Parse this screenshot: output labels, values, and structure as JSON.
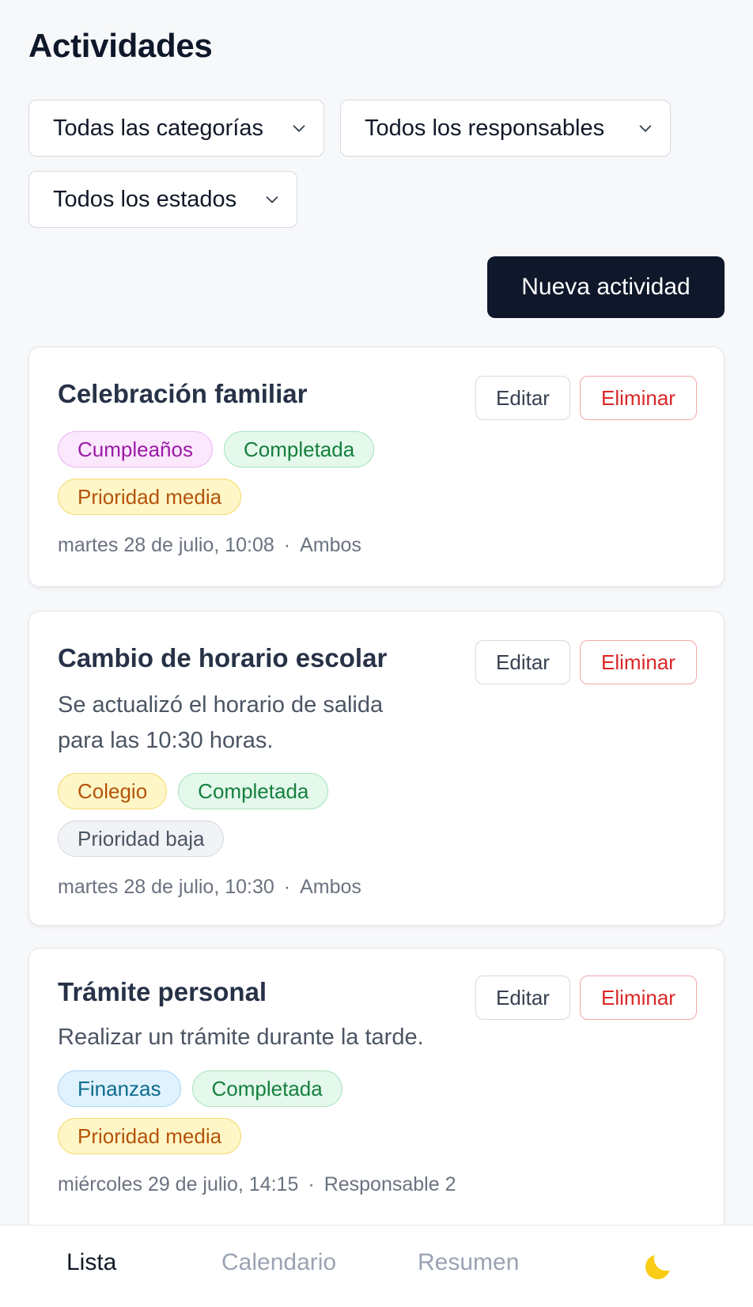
{
  "header": {
    "title": "Actividades"
  },
  "filters": {
    "category": "Todas las categorías",
    "responsible": "Todos los responsables",
    "status": "Todos los estados"
  },
  "actions": {
    "new_activity": "Nueva actividad"
  },
  "cards": [
    {
      "title": "Celebración familiar",
      "edit": "Editar",
      "delete": "Eliminar",
      "badges": [
        "Cumpleaños",
        "Completada",
        "Prioridad media"
      ],
      "date": "martes 28 de julio, 10:08",
      "separator": "·",
      "assignee": "Ambos"
    },
    {
      "title": "Cambio de horario escolar",
      "edit": "Editar",
      "delete": "Eliminar",
      "description": "Se actualizó el horario de salida para las 10:30 horas.",
      "badges": [
        "Colegio",
        "Completada",
        "Prioridad baja"
      ],
      "date": "martes 28 de julio, 10:30",
      "separator": "·",
      "assignee": "Ambos"
    },
    {
      "title": "Trámite personal",
      "edit": "Editar",
      "delete": "Eliminar",
      "description": "Realizar un trámite durante la tarde.",
      "badges": [
        "Finanzas",
        "Completada",
        "Prioridad media"
      ],
      "date": "miércoles 29 de julio, 14:15",
      "separator": "·",
      "assignee": "Responsable 2"
    }
  ],
  "nav": {
    "list": "Lista",
    "calendar": "Calendario",
    "summary": "Resumen",
    "theme_icon": "moon-icon"
  },
  "colors": {
    "primary_button": "#0f172a",
    "delete": "#dc2626",
    "moon": "#facc15"
  }
}
